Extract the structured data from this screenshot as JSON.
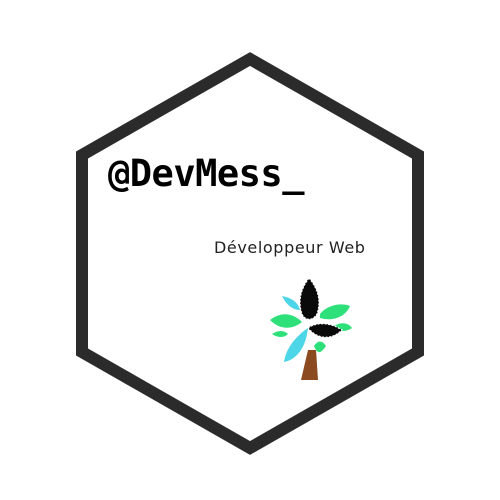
{
  "logo": {
    "handle": "@DevMess_",
    "subtitle": "Développeur Web",
    "colors": {
      "background": "#ffffff",
      "hexagon_stroke": "#2b2b2b",
      "text": "#000000",
      "leaf_green": "#2ee07a",
      "leaf_cyan": "#4dd6e8",
      "leaf_black": "#0a0a0a",
      "trunk": "#8b4a1f"
    },
    "icon": "tree-logo-icon"
  }
}
